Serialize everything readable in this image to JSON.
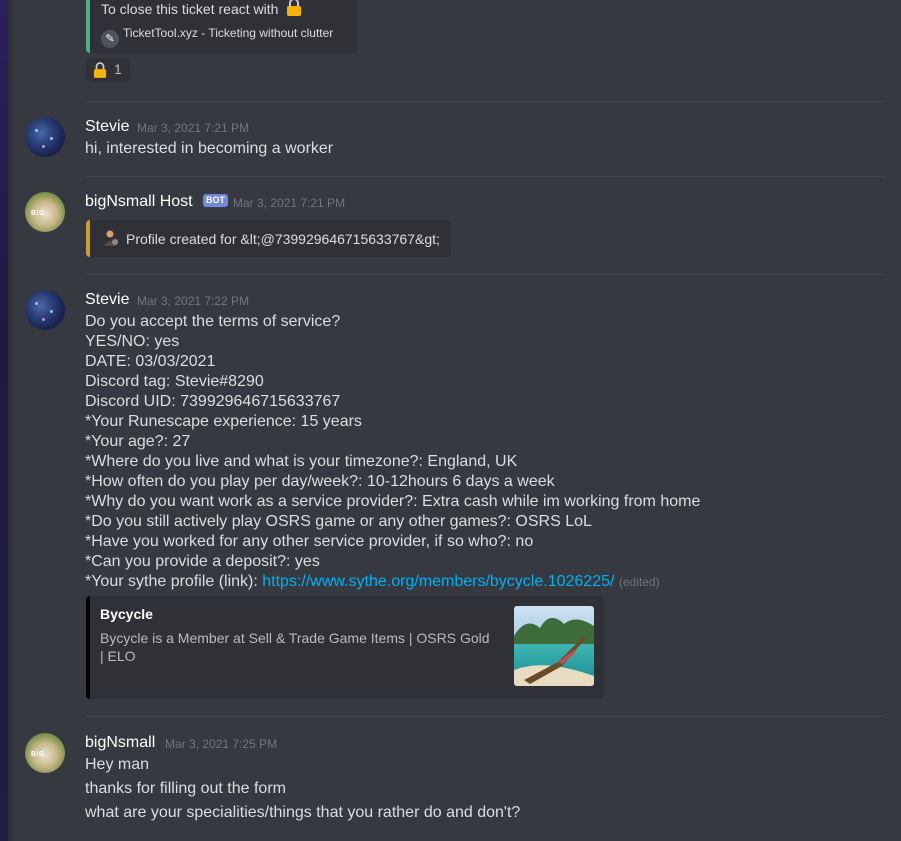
{
  "ticket_embed": {
    "close_text": "To close this ticket react with",
    "footer_text": "TicketTool.xyz - Ticketing without clutter",
    "accent_color": "#43b581"
  },
  "reaction": {
    "emoji": "lock-icon",
    "count": "1"
  },
  "messages": [
    {
      "username": "Stevie",
      "timestamp": "Mar 3, 2021 7:21 PM",
      "lines": [
        "hi, interested in becoming a worker"
      ]
    },
    {
      "username": "bigNsmall Host",
      "badge": "BOT",
      "timestamp": "Mar 3, 2021 7:21 PM",
      "embed_text": "Profile created for &lt;@739929646715633767&gt;",
      "embed_color": "#c9a227"
    },
    {
      "username": "Stevie",
      "timestamp": "Mar 3, 2021 7:22 PM",
      "lines": [
        "Do you accept the terms of service?",
        "YES/NO: yes",
        "DATE: 03/03/2021",
        "Discord tag: Stevie#8290",
        "Discord UID: 739929646715633767",
        "*Your Runescape experience: 15 years",
        "*Your age?: 27",
        "*Where do you live and what is your timezone?: England, UK",
        "*How often do you play per day/week?: 10-12hours 6 days a week",
        "*Why do you want work as a service provider?: Extra cash while im working from home",
        "*Do you still actively play OSRS game or any other games?: OSRS LoL",
        "*Have you worked for any other service provider, if so who?: no",
        "*Can you provide a deposit?: yes"
      ],
      "last_line_prefix": "*Your sythe profile (link): ",
      "link": "https://www.sythe.org/members/bycycle.1026225/",
      "edited": "(edited)",
      "link_embed": {
        "title": "Bycycle",
        "description_line1": "Bycycle is a Member at Sell & Trade Game Items | OSRS Gold",
        "description_line2": "| ELO",
        "accent_color": "#040405"
      }
    },
    {
      "username": "bigNsmall",
      "timestamp": "Mar 3, 2021 7:25 PM",
      "lines": [
        "Hey man",
        "thanks for filling out the form",
        "what are your specialities/things that you rather do and don't?"
      ]
    }
  ]
}
